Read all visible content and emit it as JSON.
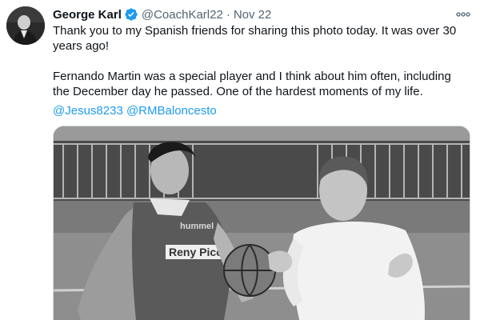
{
  "tweet": {
    "author": {
      "display_name": "George Karl",
      "handle": "@CoachKarl22",
      "verified": true,
      "avatar_icon": "profile-photo"
    },
    "date": "Nov 22",
    "separator": "·",
    "more_icon": "more-horizontal-icon",
    "text": {
      "line1": "Thank you to my Spanish friends for sharing this photo today. It was over 30 years ago!",
      "line2": "Fernando Martin was a special player and I think about him often, including the December day he passed. One of the hardest moments of my life."
    },
    "mentions": [
      "@Jesus8233",
      "@RMBaloncesto"
    ],
    "photo": {
      "jersey_text": "Reny Picot",
      "jersey_logo": "hummel"
    }
  },
  "colors": {
    "link": "#1d9bf0",
    "secondary_text": "#536471",
    "primary_text": "#0f1419",
    "verified_badge": "#1d9bf0"
  }
}
